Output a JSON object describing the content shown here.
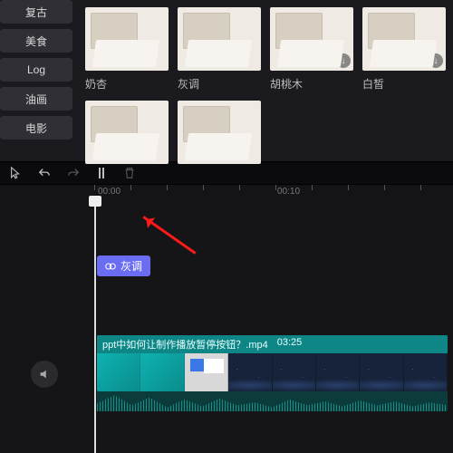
{
  "categories": [
    "复古",
    "美食",
    "Log",
    "油画",
    "电影"
  ],
  "filters": [
    {
      "name": "奶杏",
      "dl": false
    },
    {
      "name": "灰调",
      "dl": false
    },
    {
      "name": "胡桃木",
      "dl": true
    },
    {
      "name": "白皙",
      "dl": true
    },
    {
      "name": "",
      "dl": false
    },
    {
      "name": "",
      "dl": false
    }
  ],
  "applied_filter": {
    "label": "灰调"
  },
  "ruler": {
    "t0": "00:00",
    "t1": "00:10"
  },
  "video": {
    "filename": "ppt中如何让制作播放暂停按钮？.mp4",
    "duration": "03:25"
  }
}
